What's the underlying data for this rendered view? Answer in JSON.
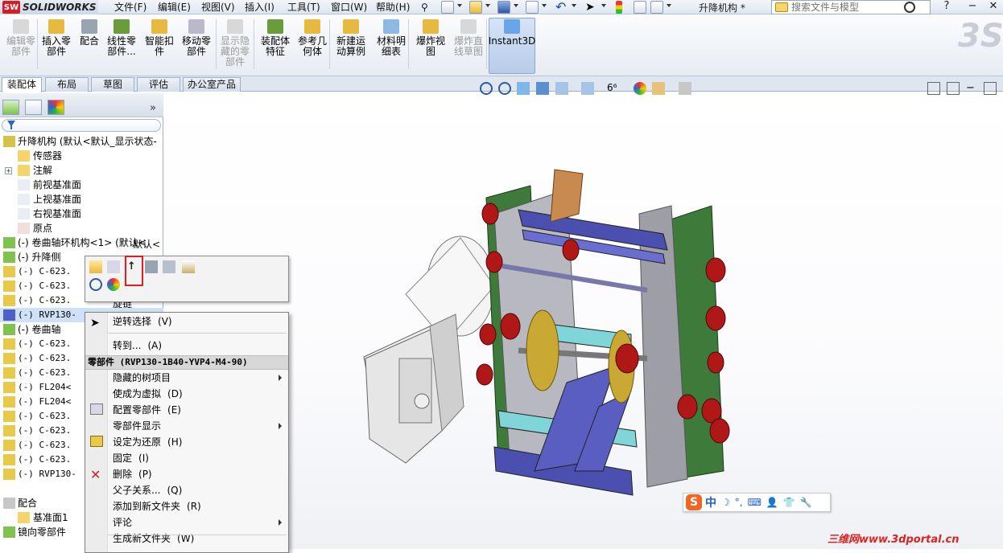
{
  "app": {
    "logo_text": "SOLIDWORKS",
    "logo_badge": "SW",
    "document_title": "升降机构 *"
  },
  "menu": [
    "文件(F)",
    "编辑(E)",
    "视图(V)",
    "插入(I)",
    "工具(T)",
    "窗口(W)",
    "帮助(H)"
  ],
  "search": {
    "placeholder": "搜索文件与模型"
  },
  "window_controls": [
    "?",
    "−",
    "✕"
  ],
  "commands": [
    {
      "label": "编辑零\n部件",
      "disabled": true
    },
    {
      "label": "插入零\n部件",
      "disabled": false
    },
    {
      "label": "配合",
      "disabled": false
    },
    {
      "label": "线性零\n部件...",
      "disabled": false
    },
    {
      "label": "智能扣\n件",
      "disabled": false
    },
    {
      "label": "移动零\n部件",
      "disabled": false
    },
    {
      "label": "显示隐\n藏的零\n部件",
      "disabled": true
    },
    {
      "label": "装配体\n特征",
      "disabled": false
    },
    {
      "label": "参考几\n何体",
      "disabled": false
    },
    {
      "label": "新建运\n动算例",
      "disabled": false
    },
    {
      "label": "材料明\n细表",
      "disabled": false
    },
    {
      "label": "爆炸视\n图",
      "disabled": false
    },
    {
      "label": "爆炸直\n线草图",
      "disabled": true
    },
    {
      "label": "Instant3D",
      "disabled": false
    }
  ],
  "tabs": [
    "装配体",
    "布局",
    "草图",
    "评估",
    "办公室产品"
  ],
  "tree": {
    "root": "升降机构  (默认<默认_显示状态-",
    "items": [
      "传感器",
      "注解",
      "前视基准面",
      "上视基准面",
      "右视基准面",
      "原点",
      "(-) 卷曲轴环机构<1> (默认<",
      "(-) 升降侧",
      "(-) C-623.",
      "(-) C-623.",
      "(-) C-623.",
      "(-) RVP130-",
      "(-) 卷曲轴",
      "(-) C-623.",
      "(-) C-623.",
      "(-) C-623.",
      "(-) FL204<",
      "(-) FL204<",
      "(-) C-623.",
      "(-) C-623.",
      "(-) C-623.",
      "(-) C-623.",
      "(-) RVP130-",
      "配合",
      "基准面1",
      "镜向零部件"
    ],
    "extra_text": [
      "默认<",
      "默认<",
      "旋链"
    ]
  },
  "context_menu": {
    "items_top": [
      {
        "label": "逆转选择",
        "key": "(V)"
      },
      {
        "label": "转到...",
        "key": "(A)"
      }
    ],
    "header": "零部件 (RVP130-1B40-YVP4-M4-90)",
    "items": [
      {
        "label": "隐藏的树项目",
        "key": "",
        "submenu": true
      },
      {
        "label": "使成为虚拟",
        "key": "(D)",
        "submenu": false
      },
      {
        "label": "配置零部件",
        "key": "(E)",
        "submenu": false
      },
      {
        "label": "零部件显示",
        "key": "",
        "submenu": true
      },
      {
        "label": "设定为还原",
        "key": "(H)",
        "submenu": false
      },
      {
        "label": "固定",
        "key": "(I)",
        "submenu": false
      },
      {
        "label": "删除",
        "key": "(P)",
        "submenu": false
      },
      {
        "label": "父子关系...",
        "key": "(Q)",
        "submenu": false
      },
      {
        "label": "添加到新文件夹",
        "key": "(R)",
        "submenu": false
      },
      {
        "label": "评论",
        "key": "",
        "submenu": true
      },
      {
        "label": "生成新文件夹",
        "key": "(W)",
        "submenu": false
      }
    ]
  },
  "ime": {
    "logo": "S",
    "mode": "中"
  },
  "watermark": "三维网www.3dportal.cn",
  "colors": {
    "accent": "#1d62c8",
    "frame_green": "#3e7a3a",
    "rail_blue": "#4b4fb0",
    "highlight_red": "#e02020"
  }
}
